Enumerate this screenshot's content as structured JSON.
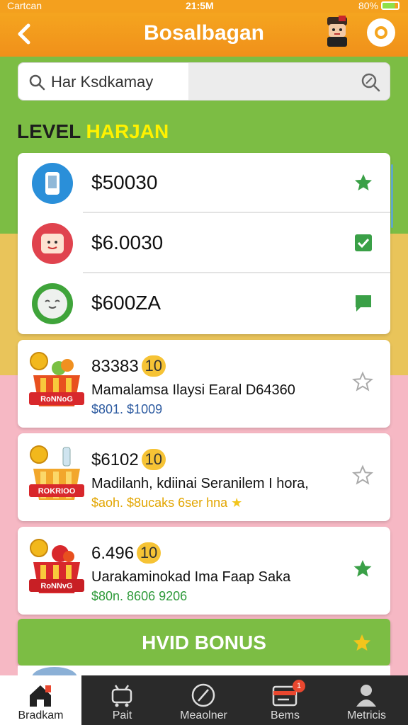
{
  "status_bar": {
    "carrier": "Cartcan",
    "time": "21:5M",
    "battery": "80%"
  },
  "header": {
    "title": "Bosalbagan"
  },
  "search": {
    "text": "Har Ksdkamay"
  },
  "section": {
    "title_part1": "LEVEL",
    "title_part2": "HARJAN"
  },
  "prices": [
    {
      "value": "$50030",
      "icon": "phone-icon",
      "mark": "star-icon",
      "circle_color": "#2a8fd9"
    },
    {
      "value": "$6.0030",
      "icon": "face-icon",
      "mark": "check-icon",
      "circle_color": "#e0434e"
    },
    {
      "value": "$600ZA",
      "icon": "smile-icon",
      "mark": "chat-icon",
      "circle_color": "#3fa43a"
    }
  ],
  "offers": [
    {
      "price": "83383",
      "badge": "10",
      "name": "Mamalamsa Ilaysi Earal D64360",
      "sub": "$801. $1009",
      "sub_color": "#2c5aa0",
      "favorite": false,
      "basket_label": "RoNNoG"
    },
    {
      "price": "$6102",
      "badge": "10",
      "name": "Madilanh, kdiinai Seranilem I hora,",
      "sub": "$aoh. $8ucaks 6ser hna",
      "sub_color": "#e2a500",
      "favorite": false,
      "basket_label": "ROKRIOO"
    },
    {
      "price": "6.496",
      "badge": "10",
      "name": "Uarakaminokad Ima Faap Saka",
      "sub": "$80n. 8606 9206",
      "sub_color": "#2e9a3a",
      "favorite": true,
      "basket_label": "RoNNvG"
    }
  ],
  "bonus": {
    "label": "HVID BONUS"
  },
  "tabs": [
    {
      "label": "Bradkam",
      "icon": "home-icon",
      "active": true
    },
    {
      "label": "Pait",
      "icon": "cart-icon",
      "active": false
    },
    {
      "label": "Meaolner",
      "icon": "compass-icon",
      "active": false
    },
    {
      "label": "Bems",
      "icon": "card-icon",
      "active": false,
      "badge": "1"
    },
    {
      "label": "Metricis",
      "icon": "user-icon",
      "active": false
    }
  ],
  "colors": {
    "header": "#f5a51f",
    "green": "#7cbd44",
    "yellow": "#e9c45a",
    "pink": "#f6b8c4",
    "badge": "#f6c335"
  }
}
